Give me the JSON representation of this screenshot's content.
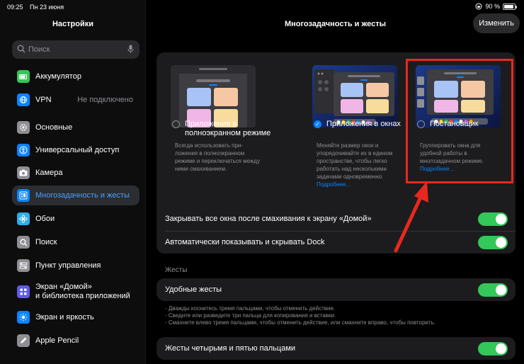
{
  "status": {
    "time": "09:25",
    "date": "Пн 23 июня",
    "battery": "90 %",
    "battery_level": 0.9
  },
  "sidebar": {
    "title": "Настройки",
    "search_placeholder": "Поиск",
    "items": [
      {
        "label": "Аккумулятор",
        "icon": "battery-icon",
        "color": "#34c759"
      },
      {
        "label": "VPN",
        "value": "Не подключено",
        "icon": "vpn-icon",
        "color": "#0a84ff"
      },
      {
        "label": "Основные",
        "icon": "gear-icon",
        "color": "#8e8e93"
      },
      {
        "label": "Универсальный доступ",
        "icon": "accessibility-icon",
        "color": "#0a84ff"
      },
      {
        "label": "Камера",
        "icon": "camera-icon",
        "color": "#8e8e93"
      },
      {
        "label": "Многозадачность и жесты",
        "icon": "multitasking-icon",
        "color": "#0a84ff"
      },
      {
        "label": "Обои",
        "icon": "wallpaper-icon",
        "color": "#32ade6"
      },
      {
        "label": "Поиск",
        "icon": "search-icon",
        "color": "#8e8e93"
      },
      {
        "label": "Пункт управления",
        "icon": "control-center-icon",
        "color": "#8e8e93"
      },
      {
        "label": "Экран «Домой»\nи библиотека приложений",
        "icon": "home-screen-icon",
        "color": "#5e5ce6"
      },
      {
        "label": "Экран и яркость",
        "icon": "brightness-icon",
        "color": "#0a84ff"
      },
      {
        "label": "Apple Pencil",
        "icon": "pencil-icon",
        "color": "#8e8e93"
      }
    ]
  },
  "main": {
    "title": "Многозадачность и жесты",
    "edit_label": "Изменить",
    "modes": [
      {
        "label": "Приложения в полноэкранном режиме",
        "selected": false,
        "desc": "Всегда использовать при-ложения в полноэкранном режиме и переключаться между ними смахиванием.",
        "more": ""
      },
      {
        "label": "Приложения в окнах",
        "selected": true,
        "desc": "Меняйте размер окон и упорядочивайте их в едином пространстве, чтобы легко работать над несколькими задачами одновременно.",
        "more": "Подробнее…"
      },
      {
        "label": "Постановщик",
        "selected": false,
        "desc": "Группировать окна для удобной работы в многозадачном режиме.",
        "more": "Подробнее…"
      }
    ],
    "toggles": [
      {
        "label": "Закрывать все окна после смахивания к экрану «Домой»",
        "on": true
      },
      {
        "label": "Автоматически показывать и скрывать Dock",
        "on": true
      }
    ],
    "gestures_header": "Жесты",
    "gesture_toggle": {
      "label": "Удобные жесты",
      "on": true
    },
    "gesture_notes": [
      "- Дважды коснитесь тремя пальцами, чтобы отменить действие.",
      "- Сведите или разведите три пальца для копирования и вставки.",
      "- Смахните влево тремя пальцами, чтобы отменить действие, или смахните вправо, чтобы повторить."
    ],
    "four_five_toggle": {
      "label": "Жесты четырьмя и пятью пальцами",
      "on": true
    }
  }
}
